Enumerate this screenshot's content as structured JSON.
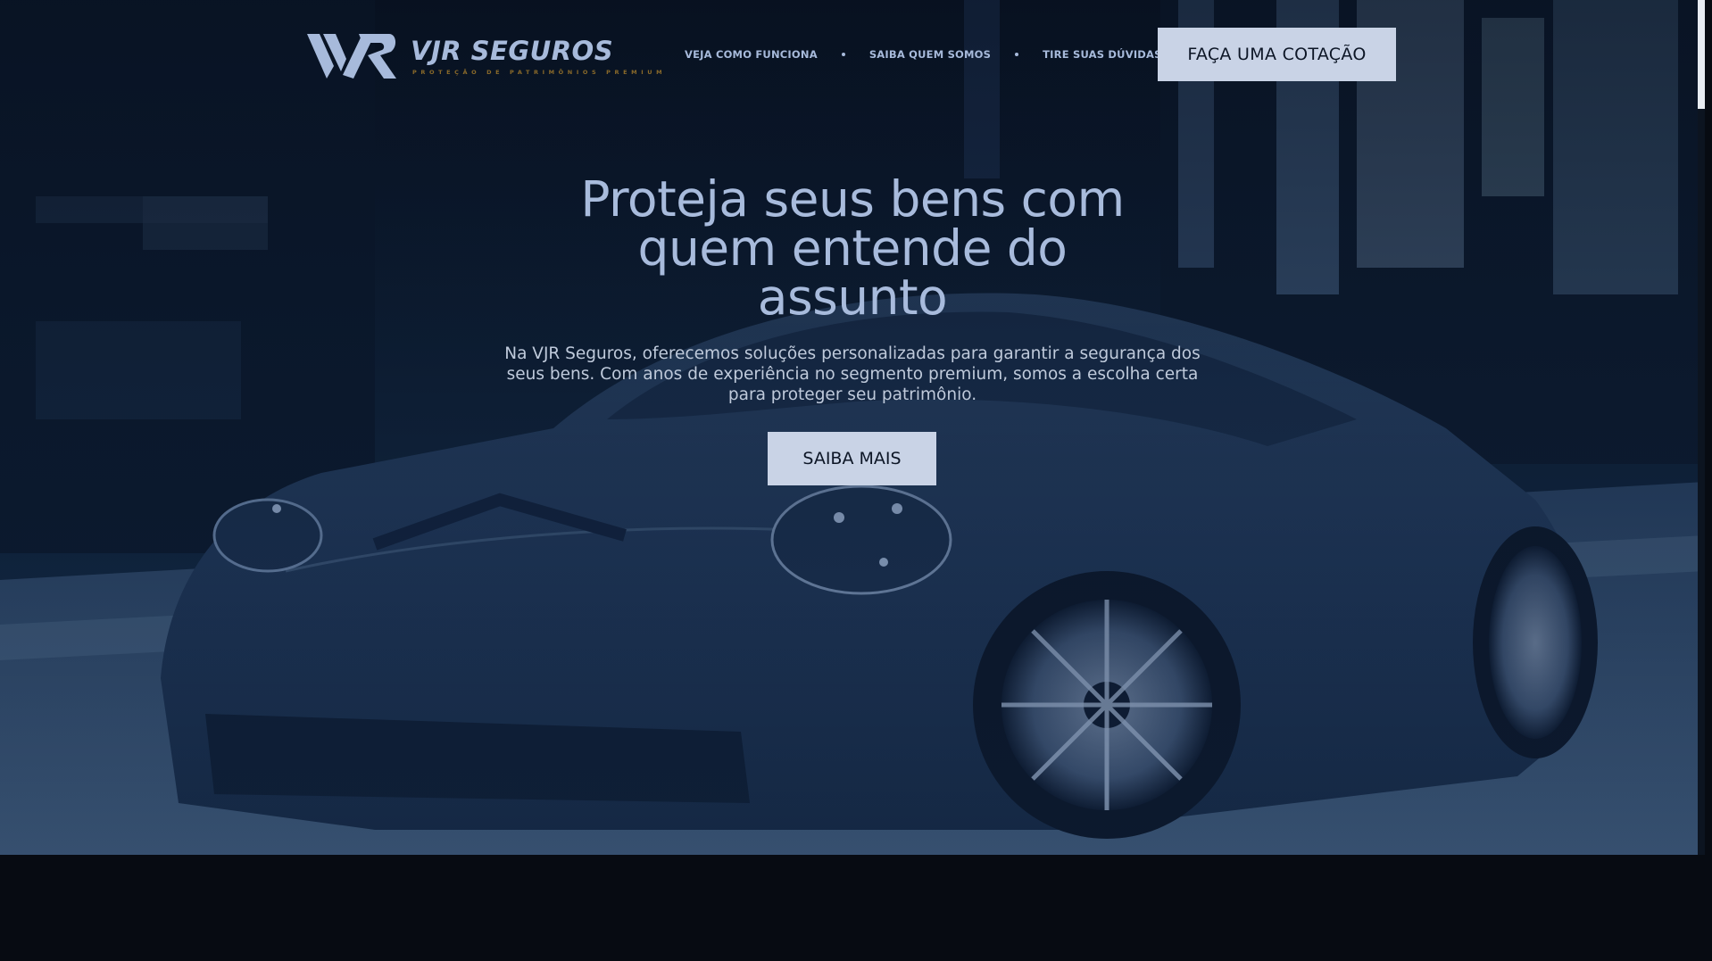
{
  "brand": {
    "name": "VJR SEGUROS",
    "tagline": "PROTEÇÃO DE PATRIMÔNIOS PREMIUM"
  },
  "nav": {
    "items": [
      {
        "label": "VEJA COMO FUNCIONA"
      },
      {
        "label": "SAIBA QUEM SOMOS"
      },
      {
        "label": "TIRE SUAS DÚVIDAS"
      }
    ],
    "cta_label": "FAÇA UMA COTAÇÃO"
  },
  "hero": {
    "title_line1": "Proteja seus bens com",
    "title_line2": "quem entende do",
    "title_line3": "assunto",
    "description": "Na VJR Seguros, oferecemos soluções personalizadas para garantir a segurança dos seus bens. Com anos de experiência no segmento premium, somos a escolha certa para proteger seu patrimônio.",
    "button_label": "SAIBA MAIS",
    "background_image": "dark blue sports car"
  },
  "colors": {
    "accent_text": "#a8bbdc",
    "button_bg": "#c9d3e6",
    "button_text": "#0d1626",
    "page_bg": "#070b12",
    "tagline_gold": "#8a6a2a"
  }
}
